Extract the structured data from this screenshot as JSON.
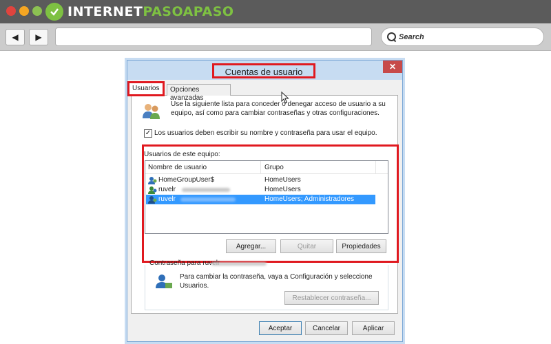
{
  "site": {
    "logo_prefix": "INTERNET",
    "logo_accent": "PASOAPASO",
    "logo_icon": "check-circle-icon",
    "colors": {
      "brand_green": "#7ec142",
      "highlight_red": "#e0191f",
      "selection_blue": "#3399ff"
    }
  },
  "browser": {
    "back_icon": "◀",
    "forward_icon": "▶",
    "search_placeholder": "Search"
  },
  "dialog": {
    "title": "Cuentas de usuario",
    "close_icon": "✕",
    "tabs": [
      {
        "label": "Usuarios",
        "active": true
      },
      {
        "label": "Opciones avanzadas",
        "active": false
      }
    ],
    "description": "Use la siguiente lista para conceder o denegar acceso de usuario a su equipo, así como para cambiar contraseñas y otras configuraciones.",
    "require_login": {
      "checked": true,
      "check_glyph": "✓",
      "label": "Los usuarios deben escribir su nombre y contraseña para usar el equipo."
    },
    "users_group_title": "Usuarios de este equipo:",
    "columns": [
      "Nombre de usuario",
      "Grupo"
    ],
    "users": [
      {
        "name": "HomeGroupUser$",
        "group": "HomeUsers",
        "selected": false
      },
      {
        "name": "ruvelr",
        "group": "HomeUsers",
        "selected": false
      },
      {
        "name": "ruvelr",
        "group": "HomeUsers; Administradores",
        "selected": true
      }
    ],
    "buttons": {
      "add": "Agregar...",
      "remove": "Quitar",
      "properties": "Propiedades"
    },
    "password_section": {
      "title": "Contraseña para ruvelr",
      "description": "Para cambiar la contraseña, vaya a Configuración y seleccione Usuarios.",
      "reset_button": "Restablecer contraseña..."
    },
    "footer": {
      "ok": "Aceptar",
      "cancel": "Cancelar",
      "apply": "Aplicar"
    }
  }
}
